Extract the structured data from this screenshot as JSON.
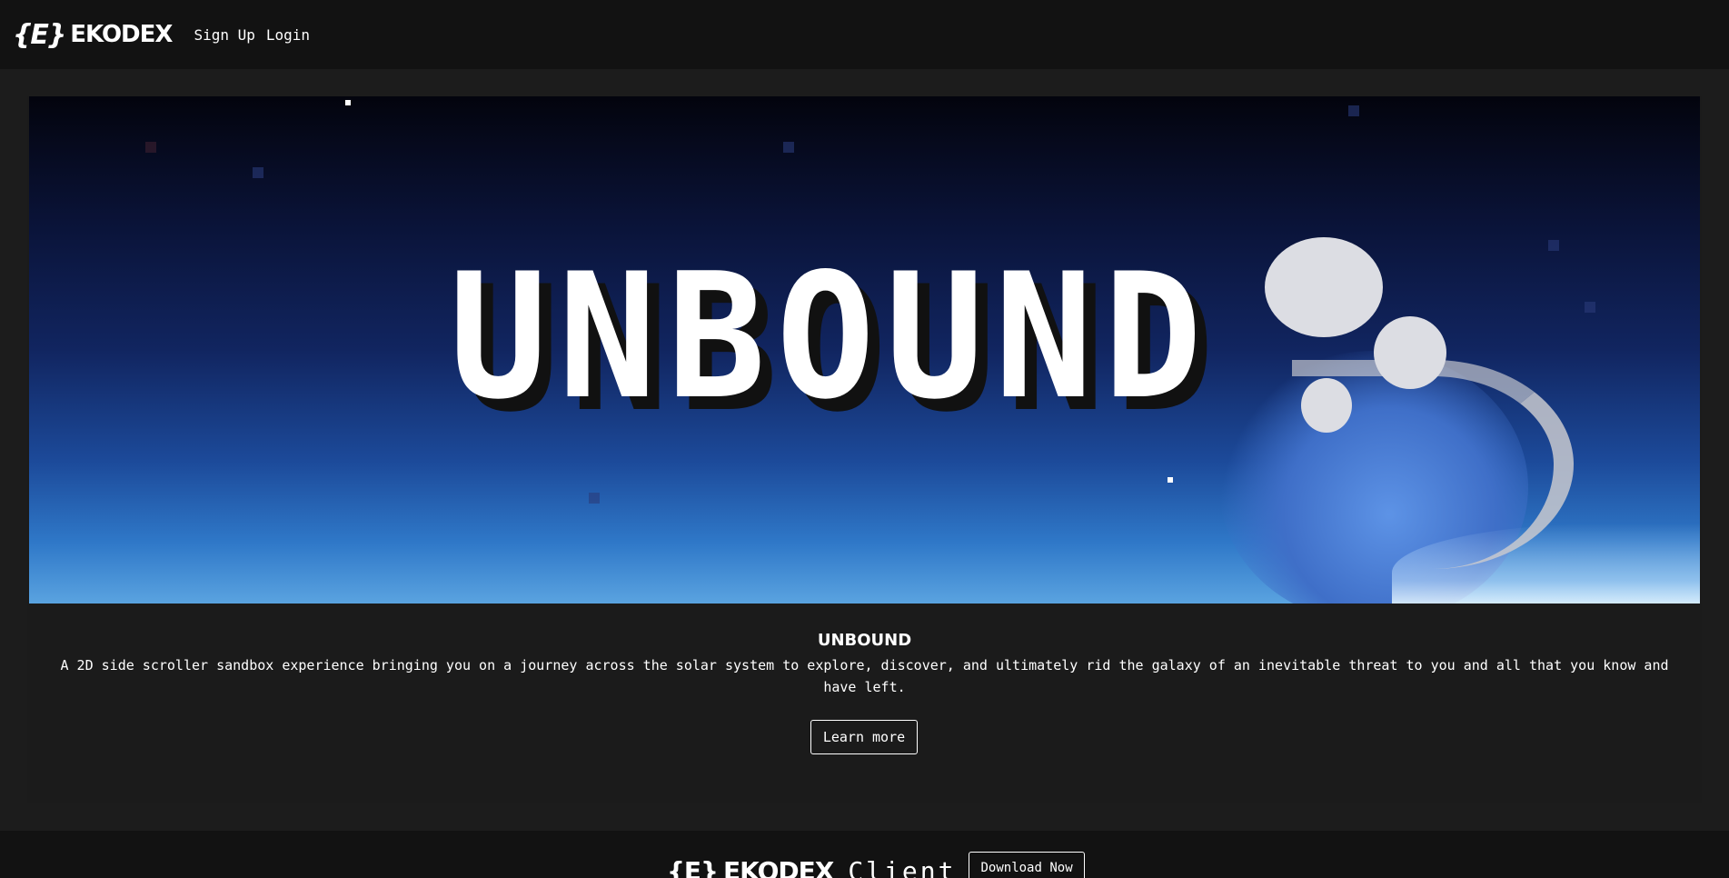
{
  "nav": {
    "brand_mark": "{E}",
    "brand_name": "EKODEX",
    "links": [
      "Sign Up",
      "Login"
    ]
  },
  "featured": {
    "banner_text": "UNBOUND",
    "title": "UNBOUND",
    "description": "A 2D side scroller sandbox experience bringing you on a journey across the solar system to explore, discover, and ultimately rid the galaxy of an inevitable threat to you and all that you know and have left.",
    "cta_label": "Learn more"
  },
  "footer": {
    "brand_mark": "{E}",
    "brand_name": "EKODEX",
    "client_label": "Client",
    "download_label": "Download Now"
  },
  "colors": {
    "nav_bg": "#121212",
    "page_bg": "#1c1c1c",
    "text": "#ffffff"
  }
}
